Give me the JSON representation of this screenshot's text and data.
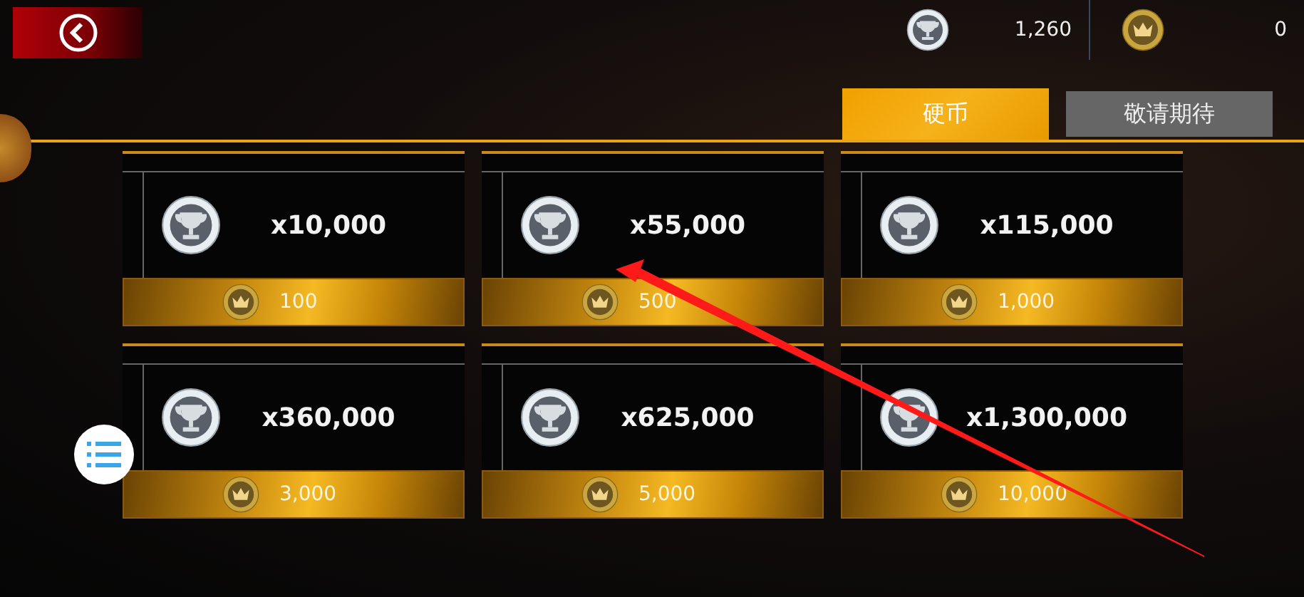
{
  "currencies": [
    {
      "kind": "silver",
      "amount": "1,260"
    },
    {
      "kind": "gold",
      "amount": "0"
    }
  ],
  "tabs": [
    {
      "label": "硬币",
      "selected": true
    },
    {
      "label": "敬请期待",
      "selected": false
    }
  ],
  "offers": [
    {
      "amount": "x10,000",
      "price": "100"
    },
    {
      "amount": "x55,000",
      "price": "500"
    },
    {
      "amount": "x115,000",
      "price": "1,000"
    },
    {
      "amount": "x360,000",
      "price": "3,000"
    },
    {
      "amount": "x625,000",
      "price": "5,000"
    },
    {
      "amount": "x1,300,000",
      "price": "10,000"
    }
  ]
}
